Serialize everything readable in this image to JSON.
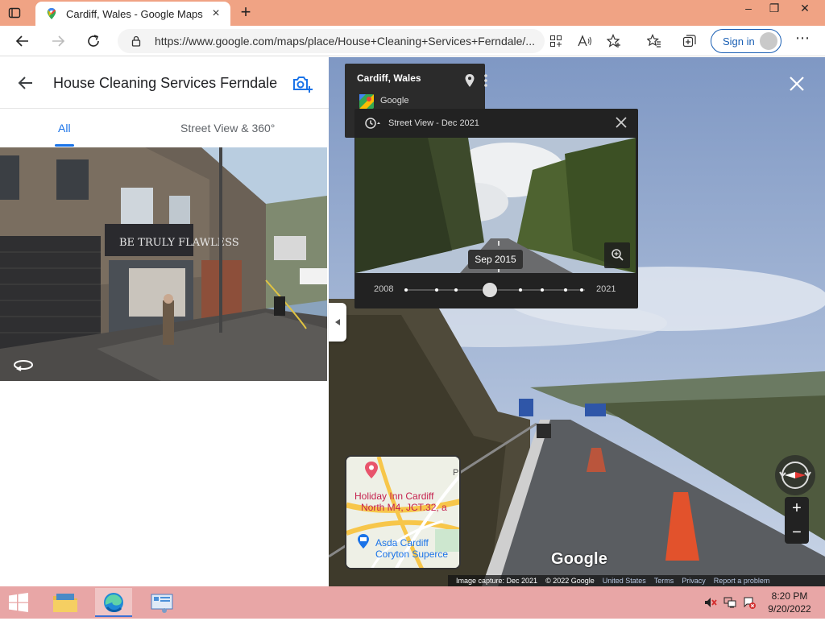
{
  "browser": {
    "tab_title": "Cardiff, Wales - Google Maps",
    "url": "https://www.google.com/maps/place/House+Cleaning+Services+Ferndale/...",
    "signin_label": "Sign in"
  },
  "left_panel": {
    "title": "House Cleaning Services Ferndale",
    "tabs": [
      {
        "label": "All",
        "active": true
      },
      {
        "label": "Street View & 360°",
        "active": false
      }
    ]
  },
  "street_view": {
    "place": "Cardiff, Wales",
    "source": "Google",
    "time_machine": {
      "header_label": "Street View - Dec 2021",
      "selected_date": "Sep 2015",
      "start_year": "2008",
      "end_year": "2021",
      "tick_count": 8,
      "selected_index": 3
    },
    "minimap": {
      "label_hotel": "Holiday Inn Cardiff North M4, JCT.32, a",
      "label_hotel_line1": "Holiday Inn Cardiff",
      "label_hotel_line2": "North M4, JCT.32, a",
      "label_store_line1": "Asda Cardiff",
      "label_store_line2": "Coryton Superce",
      "edge_letter": "P"
    },
    "watermark": "Google",
    "zoom_in": "+",
    "zoom_out": "−",
    "footer": {
      "capture": "Image capture: Dec 2021",
      "copyright": "© 2022 Google",
      "region": "United States",
      "terms": "Terms",
      "privacy": "Privacy",
      "report": "Report a problem"
    }
  },
  "taskbar": {
    "time": "8:20 PM",
    "date": "9/20/2022"
  },
  "colors": {
    "tab_bar": "#f0a384",
    "taskbar": "#e8a6a6",
    "accent_blue": "#1a73e8",
    "minimap_hotel": "#c5224f"
  }
}
